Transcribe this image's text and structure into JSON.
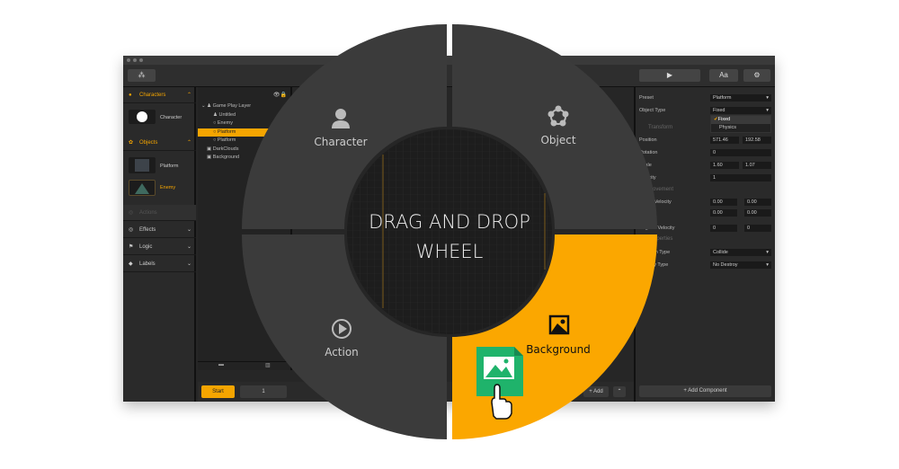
{
  "toolbar": {
    "play_icon": "play-icon",
    "font_label": "Aa",
    "settings_icon": "gear-icon"
  },
  "left_panel": {
    "characters": {
      "label": "Characters",
      "items": [
        {
          "label": "Character"
        }
      ]
    },
    "objects": {
      "label": "Objects",
      "items": [
        {
          "label": "Platform"
        },
        {
          "label": "Enemy"
        }
      ]
    },
    "sections": [
      {
        "label": "Actions"
      },
      {
        "label": "Effects"
      },
      {
        "label": "Logic"
      },
      {
        "label": "Labels"
      }
    ]
  },
  "layers": {
    "items": [
      {
        "label": "Game Play Layer"
      },
      {
        "label": "Untitled"
      },
      {
        "label": "Enemy"
      },
      {
        "label": "Platform",
        "selected": true
      },
      {
        "label": "Platform"
      },
      {
        "label": "DarkClouds"
      },
      {
        "label": "Background"
      }
    ]
  },
  "bottom": {
    "start_label": "Start",
    "frame_value": "1",
    "add_label": "+ Add"
  },
  "properties": {
    "preset_label": "Preset",
    "preset_value": "Platform",
    "object_type_label": "Object Type",
    "object_type_value": "Fixed",
    "object_type_options": [
      "Fixed",
      "Physics"
    ],
    "transform_title": "Transform",
    "position_label": "Position",
    "position_x": "571.46",
    "position_y": "192.58",
    "rotation_label": "Rotation",
    "rotation_value": "0",
    "scale_label": "Scale",
    "scale_x": "1.60",
    "scale_y": "1.07",
    "opacity_label": "Opacity",
    "opacity_value": "1",
    "movement_title": "Movement",
    "linear_velocity_label": "Linear Velocity",
    "lv1_a": "0.00",
    "lv1_b": "0.00",
    "lv2_a": "0.00",
    "lv2_b": "0.00",
    "angular_velocity_label": "Angular Velocity",
    "av_a": "0",
    "av_b": "0",
    "properties_title": "Properties",
    "collision_type_label": "Collision Type",
    "collision_type_value": "Collide",
    "destroy_type_label": "Destroy Type",
    "destroy_type_value": "No Destroy",
    "add_component_label": "+ Add Component"
  },
  "wheel": {
    "center_text_line1": "DRAG AND DROP",
    "center_text_line2": "WHEEL",
    "segments": [
      {
        "label": "Character",
        "icon": "person-icon"
      },
      {
        "label": "Object",
        "icon": "object-icon"
      },
      {
        "label": "Action",
        "icon": "play-circle-icon"
      },
      {
        "label": "Background",
        "icon": "image-icon",
        "active": true
      }
    ],
    "accent": "#fba700",
    "segment_color": "#3b3b3b"
  }
}
